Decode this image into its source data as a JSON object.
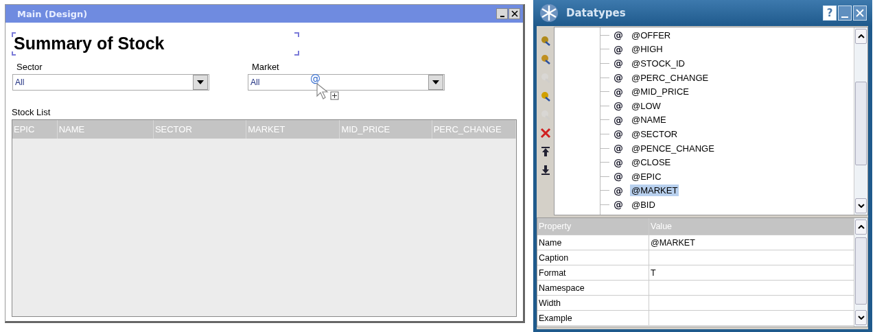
{
  "main_window": {
    "title": "Main (Design)",
    "heading": "Summary of Stock",
    "filters": [
      {
        "label": "Sector",
        "value": "All"
      },
      {
        "label": "Market",
        "value": "All"
      }
    ],
    "drag_glyph": "@",
    "grid_title": "Stock List",
    "columns": [
      "EPIC",
      "NAME",
      "SECTOR",
      "MARKET",
      "MID_PRICE",
      "PERC_CHANGE"
    ]
  },
  "datatypes_window": {
    "title": "Datatypes",
    "help": "?",
    "toolbar": [
      {
        "kind": "find",
        "disabled": false
      },
      {
        "kind": "edit",
        "disabled": false
      },
      {
        "kind": "move",
        "disabled": true
      },
      {
        "kind": "add",
        "disabled": false
      },
      {
        "kind": "copy",
        "disabled": true
      },
      {
        "kind": "delete",
        "disabled": false
      },
      {
        "kind": "top",
        "disabled": false
      },
      {
        "kind": "bottom",
        "disabled": false
      }
    ],
    "tree": [
      {
        "glyph": "@",
        "label": "@OFFER",
        "selected": false
      },
      {
        "glyph": "@",
        "label": "@HIGH",
        "selected": false
      },
      {
        "glyph": "@",
        "label": "@STOCK_ID",
        "selected": false
      },
      {
        "glyph": "@",
        "label": "@PERC_CHANGE",
        "selected": false
      },
      {
        "glyph": "@",
        "label": "@MID_PRICE",
        "selected": false
      },
      {
        "glyph": "@",
        "label": "@LOW",
        "selected": false
      },
      {
        "glyph": "@",
        "label": "@NAME",
        "selected": false
      },
      {
        "glyph": "@",
        "label": "@SECTOR",
        "selected": false
      },
      {
        "glyph": "@",
        "label": "@PENCE_CHANGE",
        "selected": false
      },
      {
        "glyph": "@",
        "label": "@CLOSE",
        "selected": false
      },
      {
        "glyph": "@",
        "label": "@EPIC",
        "selected": false
      },
      {
        "glyph": "@",
        "label": "@MARKET",
        "selected": true
      },
      {
        "glyph": "@",
        "label": "@BID",
        "selected": false
      }
    ],
    "properties": {
      "columns": [
        "Property",
        "Value"
      ],
      "rows": [
        {
          "name": "Name",
          "value": "@MARKET"
        },
        {
          "name": "Caption"
        },
        {
          "name": "Format",
          "value": "T"
        },
        {
          "name": "Namespace"
        },
        {
          "name": "Width"
        },
        {
          "name": "Example"
        }
      ]
    }
  }
}
